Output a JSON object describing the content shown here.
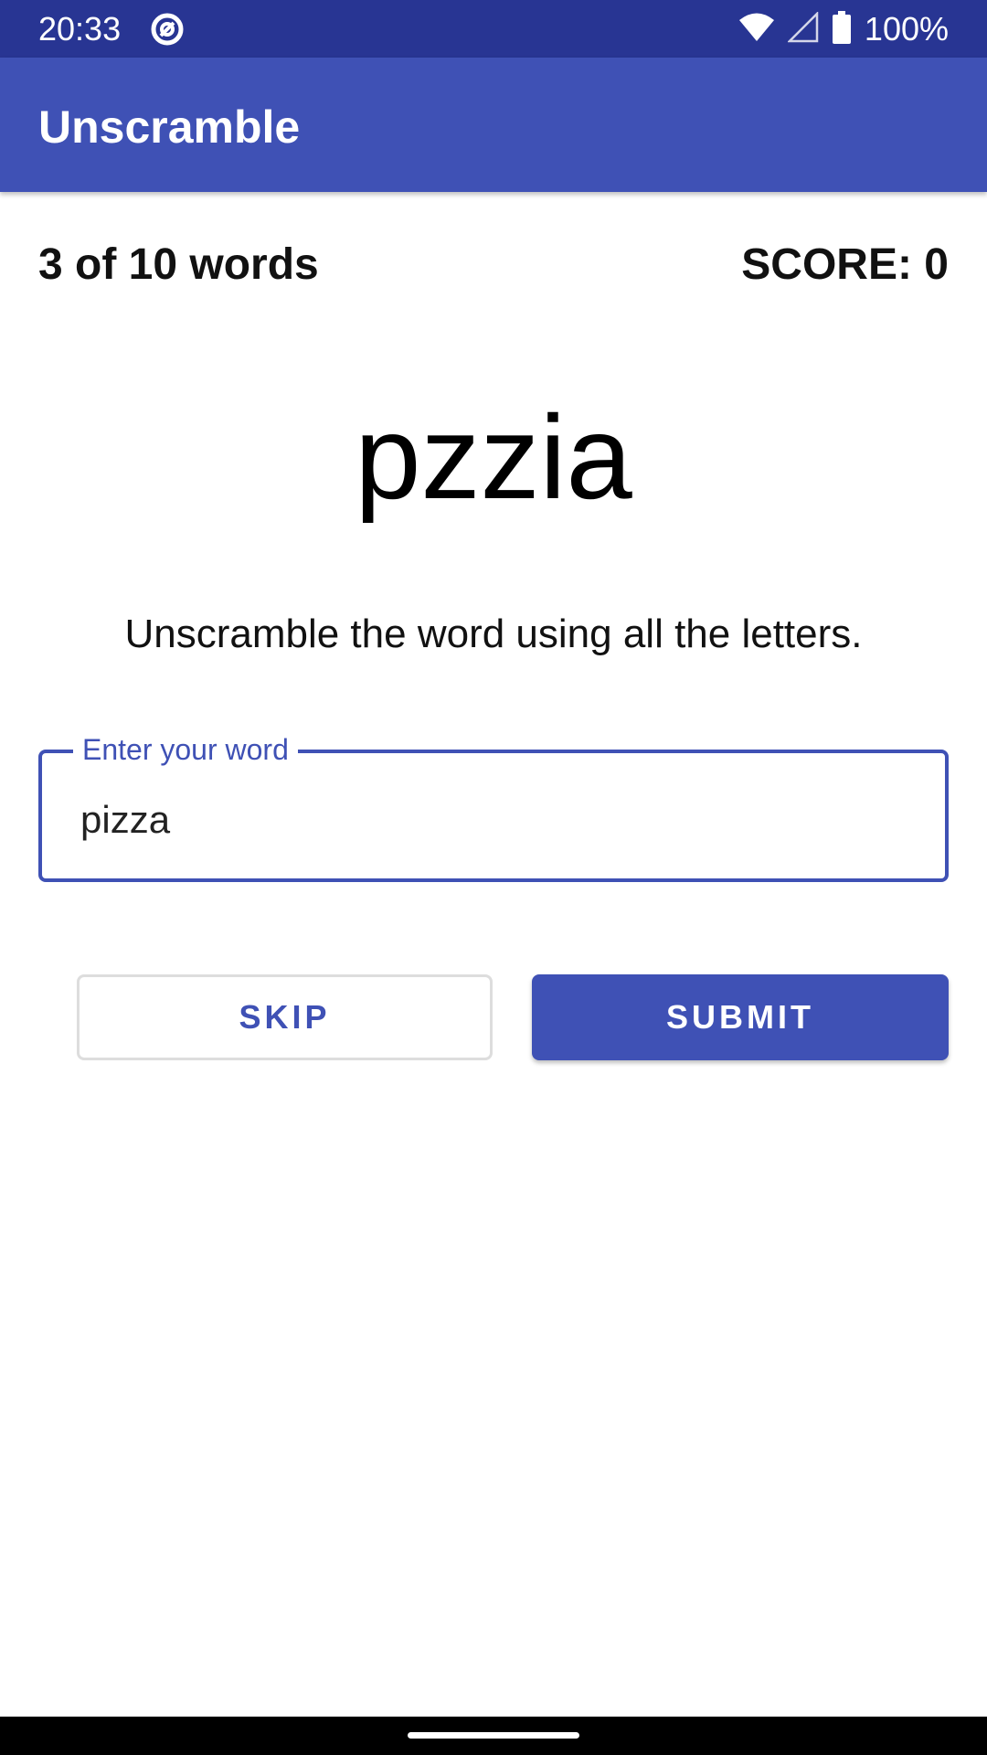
{
  "status_bar": {
    "time": "20:33",
    "battery": "100%",
    "icons": [
      "app-notification-icon",
      "wifi-icon",
      "cell-signal-icon",
      "battery-icon"
    ]
  },
  "app_bar": {
    "title": "Unscramble"
  },
  "game": {
    "word_count": "3 of 10 words",
    "score": "SCORE: 0",
    "scrambled_word": "pzzia",
    "instructions": "Unscramble the word using all the letters."
  },
  "input": {
    "label": "Enter your word",
    "value": "pizza"
  },
  "buttons": {
    "skip": "SKIP",
    "submit": "SUBMIT"
  },
  "colors": {
    "primary": "#3f51b5",
    "primary_dark": "#283593"
  }
}
